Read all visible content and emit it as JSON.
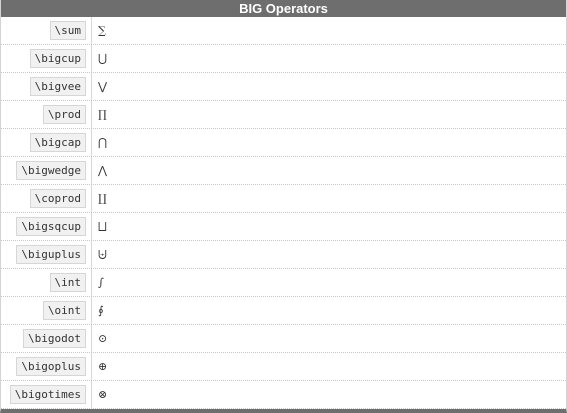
{
  "header": {
    "title": "BIG Operators"
  },
  "rows": [
    {
      "command": "\\sum",
      "symbol": "∑"
    },
    {
      "command": "\\bigcup",
      "symbol": "⋃"
    },
    {
      "command": "\\bigvee",
      "symbol": "⋁"
    },
    {
      "command": "\\prod",
      "symbol": "∏"
    },
    {
      "command": "\\bigcap",
      "symbol": "⋂"
    },
    {
      "command": "\\bigwedge",
      "symbol": "⋀"
    },
    {
      "command": "\\coprod",
      "symbol": "∐"
    },
    {
      "command": "\\bigsqcup",
      "symbol": "⨆"
    },
    {
      "command": "\\biguplus",
      "symbol": "⨄"
    },
    {
      "command": "\\int",
      "symbol": "∫"
    },
    {
      "command": "\\oint",
      "symbol": "∮"
    },
    {
      "command": "\\bigodot",
      "symbol": "⊙"
    },
    {
      "command": "\\bigoplus",
      "symbol": "⊕"
    },
    {
      "command": "\\bigotimes",
      "symbol": "⊗"
    }
  ]
}
